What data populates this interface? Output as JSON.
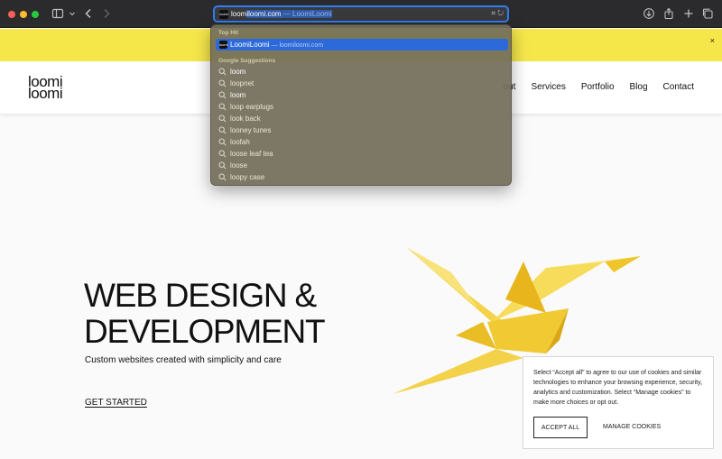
{
  "browser": {
    "url_domain": "loomiloomi.com",
    "url_separator": " — ",
    "url_title": "LoomiLoomi",
    "url_prefix": "loom",
    "url_selected": "iloomi.com"
  },
  "dropdown": {
    "top_hit_heading": "Top Hit",
    "top_hit_title": "LoomiLoomi",
    "top_hit_sub": " — loomiloomi.com",
    "google_heading": "Google Suggestions",
    "suggestions": [
      {
        "label": "loom"
      },
      {
        "label": "loopnet"
      },
      {
        "label": "loom"
      },
      {
        "label": "loop earplugs"
      },
      {
        "label": "look back"
      },
      {
        "label": "looney tunes"
      },
      {
        "label": "loofah"
      },
      {
        "label": "loose leaf tea"
      },
      {
        "label": "loose"
      },
      {
        "label": "loopy case"
      }
    ]
  },
  "banner": {
    "close": "×"
  },
  "header": {
    "logo_line1": "loomi",
    "logo_line2": "loomi",
    "nav": [
      "out",
      "Services",
      "Portfolio",
      "Blog",
      "Contact"
    ]
  },
  "hero": {
    "title_line1": "WEB DESIGN &",
    "title_line2": "DEVELOPMENT",
    "subtitle": "Custom websites created with simplicity and care",
    "cta": "GET STARTED"
  },
  "cookie": {
    "text": "Select “Accept all” to agree to our use of cookies and similar technologies to enhance your browsing experience, security, analytics and customization. Select “Manage cookies” to make more choices or opt out.",
    "accept": "ACCEPT ALL",
    "manage": "MANAGE COOKIES"
  },
  "colors": {
    "accent": "#2f7ef1",
    "banner": "#f5e64a",
    "crane": "#f2cf2e"
  },
  "icons": [
    "sidebar-icon",
    "back-icon",
    "forward-icon",
    "translate-icon",
    "reload-icon",
    "download-icon",
    "share-icon",
    "new-tab-icon",
    "tabs-overview-icon",
    "search-icon",
    "close-icon"
  ]
}
